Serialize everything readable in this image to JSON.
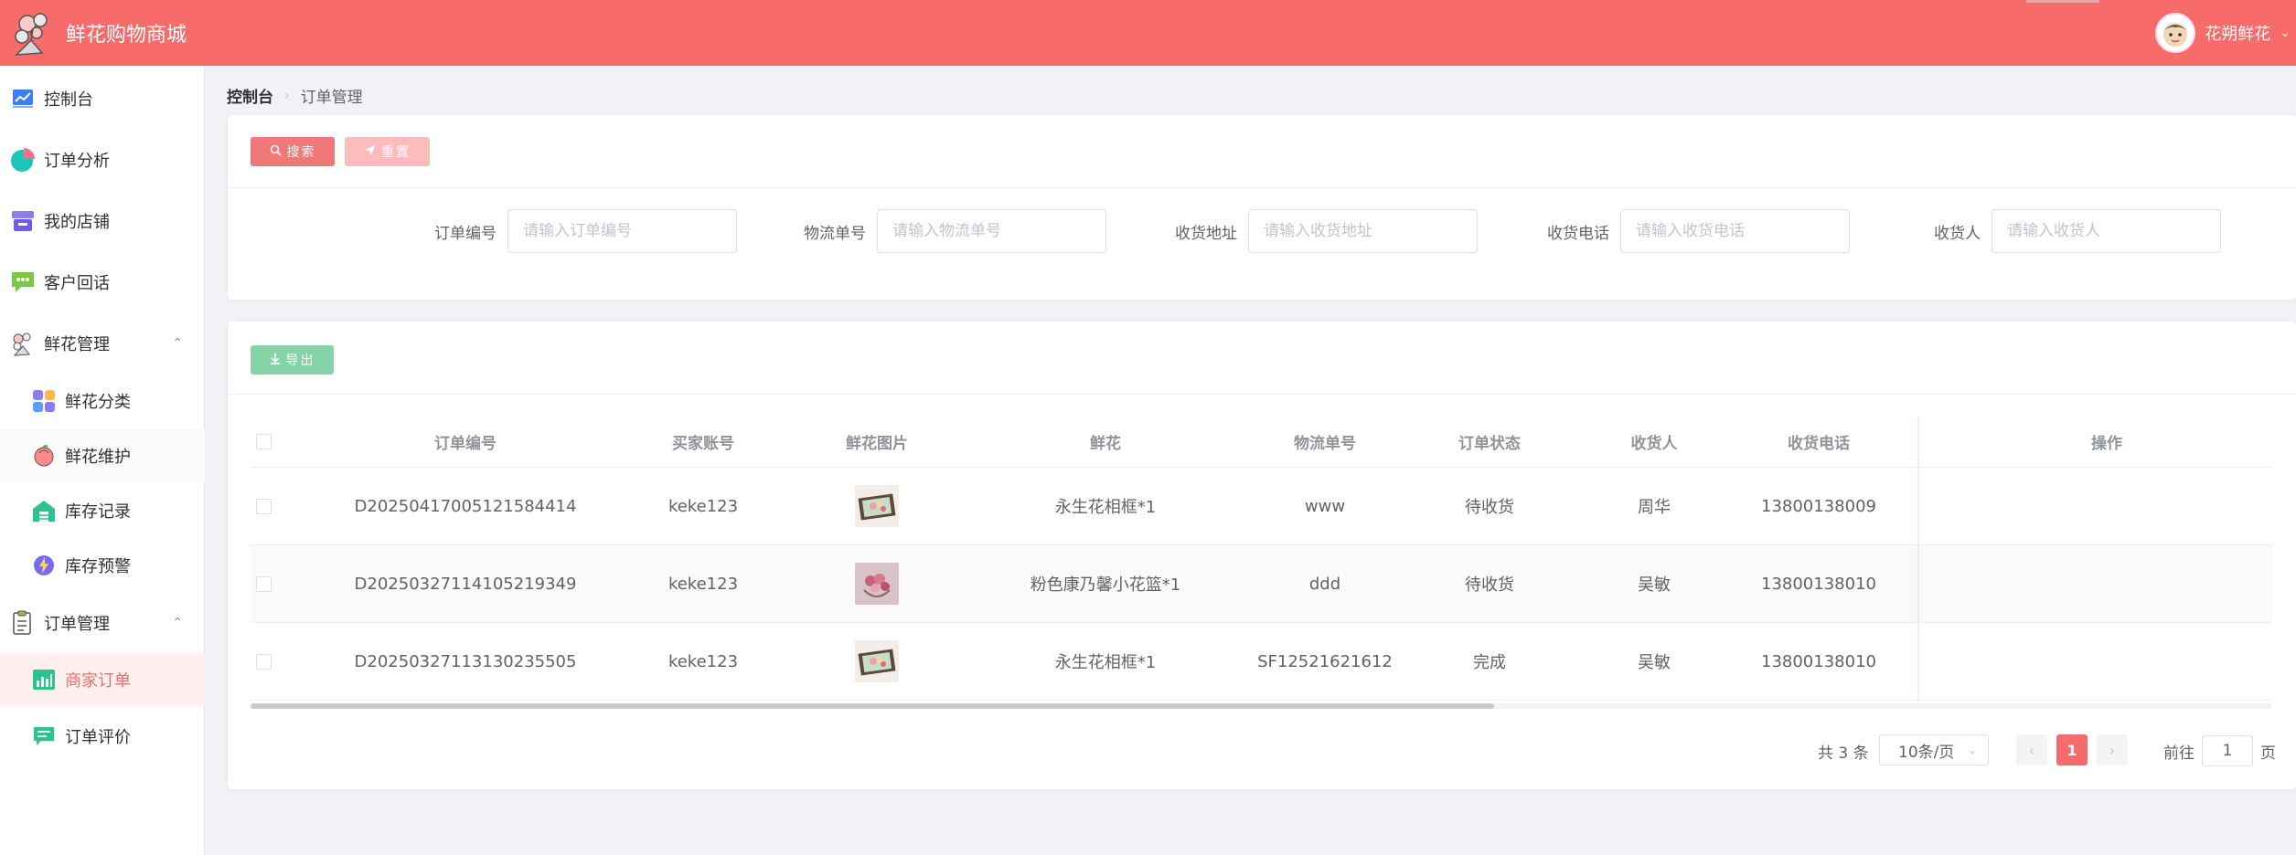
{
  "app": {
    "title": "鲜花购物商城"
  },
  "user": {
    "name": "花朔鲜花"
  },
  "sidebar": {
    "items": [
      {
        "label": "控制台",
        "icon": "line-chart-icon"
      },
      {
        "label": "订单分析",
        "icon": "pie-chart-icon"
      },
      {
        "label": "我的店铺",
        "icon": "store-icon"
      },
      {
        "label": "客户回话",
        "icon": "chat-bubble-icon"
      },
      {
        "label": "鲜花管理",
        "icon": "flower-icon",
        "expanded": true
      },
      {
        "label": "鲜花分类",
        "icon": "category-grid-icon"
      },
      {
        "label": "鲜花维护",
        "icon": "peach-flower-icon"
      },
      {
        "label": "库存记录",
        "icon": "warehouse-icon"
      },
      {
        "label": "库存预警",
        "icon": "lightning-icon"
      },
      {
        "label": "订单管理",
        "icon": "clipboard-icon",
        "expanded": true
      },
      {
        "label": "商家订单",
        "icon": "bar-chart-icon",
        "active": true
      },
      {
        "label": "订单评价",
        "icon": "comment-list-icon"
      }
    ]
  },
  "breadcrumb": {
    "root": "控制台",
    "current": "订单管理"
  },
  "toolbar": {
    "search_label": "搜索",
    "reset_label": "重置",
    "export_label": "导出"
  },
  "filters": [
    {
      "label": "订单编号",
      "placeholder": "请输入订单编号"
    },
    {
      "label": "物流单号",
      "placeholder": "请输入物流单号"
    },
    {
      "label": "收货地址",
      "placeholder": "请输入收货地址"
    },
    {
      "label": "收货电话",
      "placeholder": "请输入收货电话"
    },
    {
      "label": "收货人",
      "placeholder": "请输入收货人"
    }
  ],
  "table": {
    "headers": [
      "订单编号",
      "买家账号",
      "鲜花图片",
      "鲜花",
      "物流单号",
      "订单状态",
      "收货人",
      "收货电话",
      "操作"
    ],
    "rows": [
      {
        "order_no": "D2025041700512158441​4",
        "buyer": "keke123",
        "flower": "永生花相框*1",
        "tracking": "www",
        "status": "待收货",
        "receiver": "周华",
        "phone": "13800138009",
        "image": "frame-bouquet-image"
      },
      {
        "order_no": "D20250327114105219349",
        "buyer": "keke123",
        "flower": "粉色康乃馨小花篮*1",
        "tracking": "ddd",
        "status": "待收货",
        "receiver": "吴敏",
        "phone": "13800138010",
        "image": "pink-basket-image"
      },
      {
        "order_no": "D20250327113130235505",
        "buyer": "keke123",
        "flower": "永生花相框*1",
        "tracking": "SF12521621612",
        "status": "完成",
        "receiver": "吴敏",
        "phone": "13800138010",
        "image": "frame-bouquet-image"
      }
    ]
  },
  "pagination": {
    "total": "共 3 条",
    "page_size": "10条/页",
    "current": "1",
    "goto_prefix": "前往",
    "goto_value": "1",
    "goto_suffix": "页"
  },
  "colors": {
    "accent": "#f86b6b",
    "active": "#f56c6c",
    "export": "#86d3a8"
  }
}
